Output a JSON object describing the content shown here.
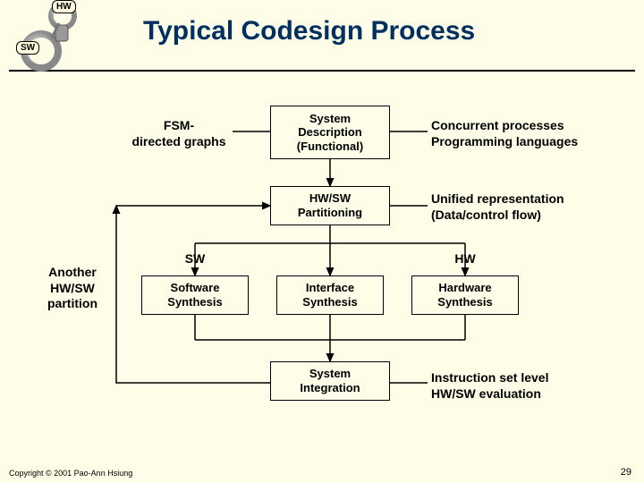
{
  "header": {
    "title": "Typical Codesign Process",
    "tag_hw": "HW",
    "tag_sw": "SW"
  },
  "nodes": {
    "sys_desc": "System\nDescription\n(Functional)",
    "partitioning": "HW/SW\nPartitioning",
    "soft_syn": "Software\nSynthesis",
    "iface_syn": "Interface\nSynthesis",
    "hard_syn": "Hardware\nSynthesis",
    "sys_int": "System\nIntegration"
  },
  "labels": {
    "fsm": "FSM-\ndirected graphs",
    "concurrent": "Concurrent processes\nProgramming languages",
    "unified": "Unified representation\n(Data/control flow)",
    "sw": "SW",
    "hw": "HW",
    "another": "Another\nHW/SW\npartition",
    "instr": "Instruction set level\nHW/SW evaluation"
  },
  "footer": {
    "copyright": "Copyright © 2001 Pao-Ann Hsiung",
    "page": "29"
  }
}
